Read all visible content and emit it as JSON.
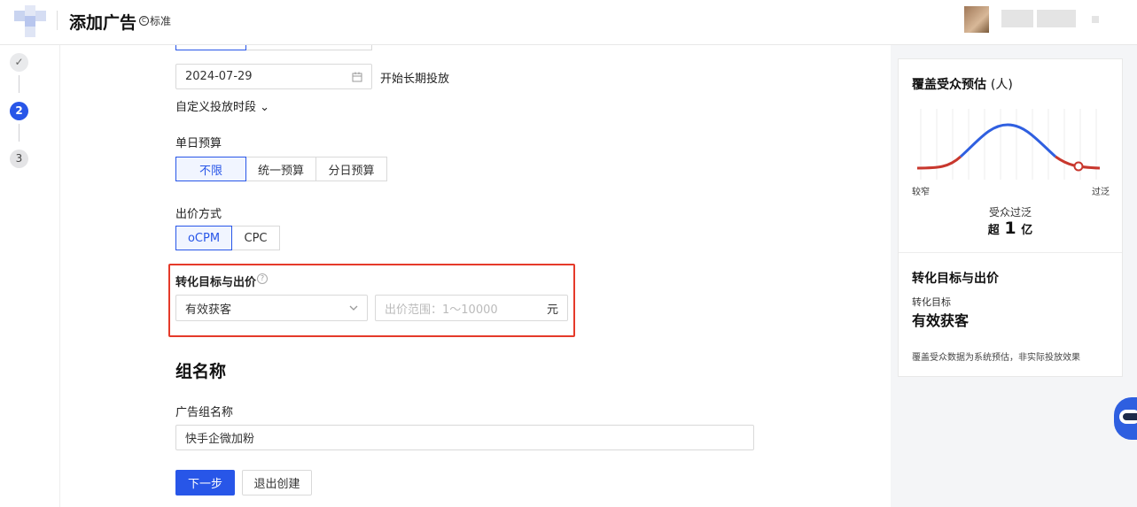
{
  "header": {
    "title": "添加广告",
    "edition_icon": "C",
    "edition_label": "标准"
  },
  "steps": [
    {
      "label": "✓",
      "state": "done"
    },
    {
      "label": "2",
      "state": "active"
    },
    {
      "label": "3",
      "state": "todo"
    }
  ],
  "schedule": {
    "start_date": "2024-07-29",
    "long_term_label": "开始长期投放",
    "custom_time_label": "自定义投放时段 ⌄"
  },
  "budget": {
    "label": "单日预算",
    "options": [
      "不限",
      "统一预算",
      "分日预算"
    ],
    "selected": "不限"
  },
  "bid_method": {
    "label": "出价方式",
    "options": [
      "oCPM",
      "CPC"
    ],
    "selected": "oCPM"
  },
  "conversion": {
    "label": "转化目标与出价",
    "help_icon": "?",
    "target_value": "有效获客",
    "bid_placeholder": "出价范围：1～10000",
    "unit": "元"
  },
  "group": {
    "section_title": "组名称",
    "name_label": "广告组名称",
    "name_value": "快手企微加粉"
  },
  "actions": {
    "next": "下一步",
    "exit": "退出创建"
  },
  "audience_card": {
    "title": "覆盖受众预估",
    "title_unit": "(人)",
    "axis_left": "较窄",
    "axis_right": "过泛",
    "status": "受众过泛",
    "size_prefix": "超",
    "size_number": "1",
    "size_unit": "亿",
    "colors": {
      "curve_main": "#2f5fe0",
      "curve_edge": "#c8372d"
    }
  },
  "conversion_card": {
    "title": "转化目标与出价",
    "target_label": "转化目标",
    "target_value": "有效获客",
    "disclaimer": "覆盖受众数据为系统预估，非实际投放效果"
  }
}
